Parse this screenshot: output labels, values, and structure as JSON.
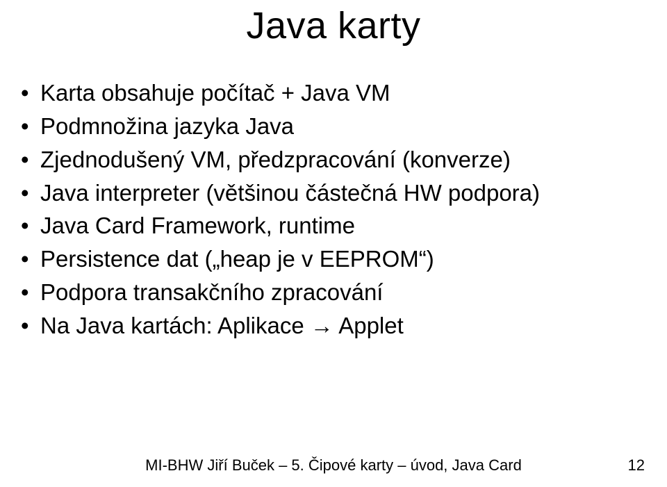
{
  "title": "Java karty",
  "bullets": [
    "Karta obsahuje počítač + Java VM",
    "Podmnožina jazyka Java",
    "Zjednodušený VM, předzpracování (konverze)",
    "Java interpreter (většinou částečná HW podpora)",
    "Java Card Framework, runtime",
    "Persistence dat („heap je v EEPROM“)",
    "Podpora transakčního zpracování",
    "Na Java kartách: Aplikace → Applet"
  ],
  "footer": "MI-BHW Jiří Buček – 5. Čipové karty – úvod, Java Card",
  "page_number": "12"
}
